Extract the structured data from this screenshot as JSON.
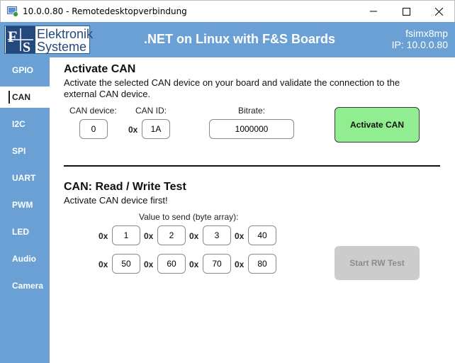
{
  "window": {
    "title": "10.0.0.80 - Remotedesktopverbindung"
  },
  "header": {
    "logo_line1": "Elektronik",
    "logo_line2": "Systeme",
    "logo_mark": "F&S",
    "title": ".NET on Linux with F&S Boards",
    "device": "fsimx8mp",
    "ip": "IP: 10.0.0.80"
  },
  "sidebar": {
    "items": [
      {
        "label": "GPIO"
      },
      {
        "label": "CAN"
      },
      {
        "label": "I2C"
      },
      {
        "label": "SPI"
      },
      {
        "label": "UART"
      },
      {
        "label": "PWM"
      },
      {
        "label": "LED"
      },
      {
        "label": "Audio"
      },
      {
        "label": "Camera"
      }
    ],
    "active": "CAN"
  },
  "activate": {
    "heading": "Activate CAN",
    "description_line1": "Activate the selected CAN device on your board and validate the connection to the",
    "description_line2": "external CAN device.",
    "device_label": "CAN device:",
    "device_value": "0",
    "id_label": "CAN ID:",
    "id_prefix": "0x",
    "id_value": "1A",
    "bitrate_label": "Bitrate:",
    "bitrate_value": "1000000",
    "button": "Activate CAN",
    "button_color": "#90ee90"
  },
  "rwtest": {
    "heading": "CAN: Read / Write Test",
    "note": "Activate CAN device first!",
    "bytes_label": "Value to send (byte array):",
    "prefix": "0x",
    "row1": [
      "1",
      "2",
      "3",
      "40"
    ],
    "row2": [
      "50",
      "60",
      "70",
      "80"
    ],
    "button": "Start RW Test"
  },
  "colors": {
    "accent": "#6aa0d4",
    "header_text": "#ffffff",
    "disabled_button": "#cccccc"
  }
}
